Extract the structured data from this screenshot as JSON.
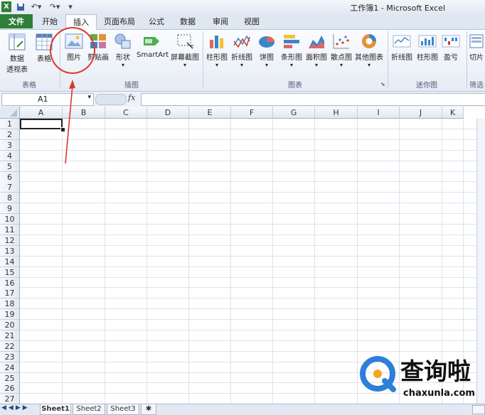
{
  "window": {
    "title": "工作簿1 - Microsoft Excel"
  },
  "tabs": [
    {
      "label": "文件"
    },
    {
      "label": "开始"
    },
    {
      "label": "插入"
    },
    {
      "label": "页面布局"
    },
    {
      "label": "公式"
    },
    {
      "label": "数据"
    },
    {
      "label": "审阅"
    },
    {
      "label": "视图"
    }
  ],
  "ribbon": {
    "groups": {
      "tables": "表格",
      "illustrations": "插图",
      "charts": "图表",
      "sparklines": "迷你图",
      "filter": "筛选"
    },
    "buttons": {
      "pivot": "数据",
      "pivot2": "透视表",
      "table": "表格",
      "picture": "图片",
      "clipart": "剪贴画",
      "shapes": "形状",
      "smartart": "SmartArt",
      "screenshot": "屏幕截图",
      "column": "柱形图",
      "line": "折线图",
      "pie": "饼图",
      "bar": "条形图",
      "area": "面积图",
      "scatter": "散点图",
      "other": "其他图表",
      "spark_line": "折线图",
      "spark_column": "柱形图",
      "spark_winloss": "盈亏",
      "slicer": "切片"
    }
  },
  "formula_bar": {
    "name_box": "A1",
    "fx": "fx",
    "value": ""
  },
  "columns": [
    "A",
    "B",
    "C",
    "D",
    "E",
    "F",
    "G",
    "H",
    "I",
    "J",
    "K"
  ],
  "rows": [
    "1",
    "2",
    "3",
    "4",
    "5",
    "6",
    "7",
    "8",
    "9",
    "10",
    "11",
    "12",
    "13",
    "14",
    "15",
    "16",
    "17",
    "18",
    "19",
    "20",
    "21",
    "22",
    "23",
    "24",
    "25",
    "26",
    "27"
  ],
  "sheets": [
    "Sheet1",
    "Sheet2",
    "Sheet3"
  ],
  "watermark": {
    "brand": "查询啦",
    "domain": "chaxunla.com"
  },
  "colors": {
    "file_tab": "#2f7e3a",
    "annotation": "#d9392c",
    "watermark_blue": "#2f7fd8"
  }
}
